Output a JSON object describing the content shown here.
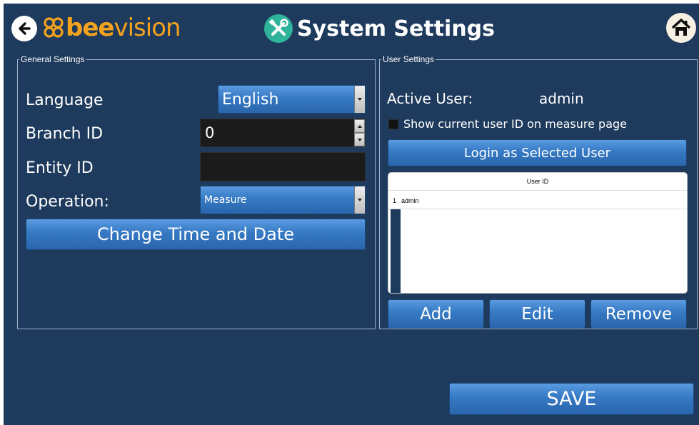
{
  "header": {
    "logo_bold": "bee",
    "logo_rest": "vision",
    "title": "System Settings"
  },
  "general_settings": {
    "legend": "General Settings",
    "language": {
      "label": "Language",
      "value": "English"
    },
    "branch_id": {
      "label": "Branch ID",
      "value": "0"
    },
    "entity_id": {
      "label": "Entity ID",
      "value": ""
    },
    "operation": {
      "label": "Operation:",
      "value": "Measure"
    },
    "change_time_button": "Change Time and Date"
  },
  "user_settings": {
    "legend": "User Settings",
    "active_user_label": "Active User:",
    "active_user_value": "admin",
    "show_user_id_checkbox": "Show current user ID on measure page",
    "login_button": "Login as Selected User",
    "table": {
      "column_header": "User ID",
      "rows": [
        {
          "index": "1",
          "user_id": "admin"
        }
      ]
    },
    "add_button": "Add",
    "edit_button": "Edit",
    "remove_button": "Remove"
  },
  "save_button": "SAVE",
  "colors": {
    "background": "#1e3a5c",
    "accent_orange": "#f2a21c",
    "button_blue": "#3679c4",
    "title_icon_teal": "#2fb39a"
  },
  "icons": {
    "back": "back-arrow-icon",
    "logo": "bee-logo-icon",
    "title": "tools-icon",
    "home": "home-icon"
  }
}
